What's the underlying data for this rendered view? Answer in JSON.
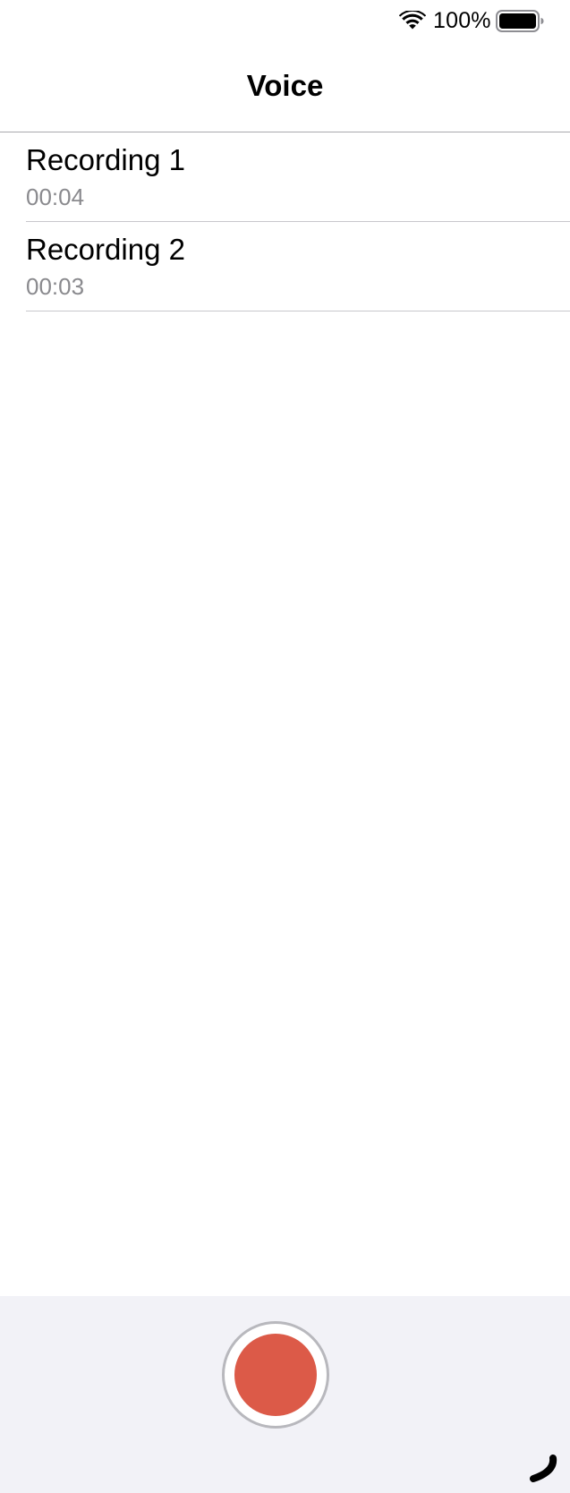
{
  "status_bar": {
    "battery_percent": "100%",
    "wifi_icon": "wifi-icon",
    "battery_icon": "battery-full-icon",
    "battery_level": 1.0
  },
  "nav": {
    "title": "Voice"
  },
  "recordings": [
    {
      "title": "Recording 1",
      "duration": "00:04"
    },
    {
      "title": "Recording 2",
      "duration": "00:03"
    }
  ],
  "toolbar": {
    "record_icon": "record-icon",
    "record_color": "#dc5a48",
    "corner_icon": "curved-stroke-icon"
  }
}
